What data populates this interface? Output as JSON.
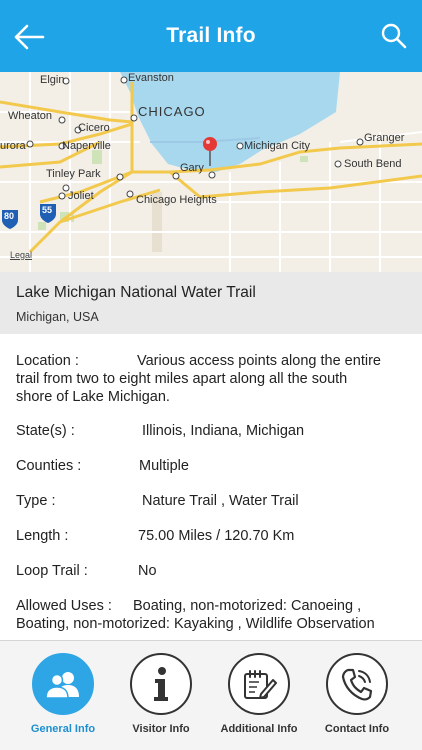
{
  "header": {
    "title": "Trail Info"
  },
  "map": {
    "labels": {
      "elgin": "Elgin",
      "evanston": "Evanston",
      "wheaton": "Wheaton",
      "chicago": "CHICAGO",
      "cicero": "Cicero",
      "aurora": "urora",
      "naperville": "Naperville",
      "michigan_city": "Michigan City",
      "granger": "Granger",
      "south_bend": "South Bend",
      "tinley_park": "Tinley Park",
      "gary": "Gary",
      "joliet": "Joliet",
      "chicago_heights": "Chicago Heights",
      "i80": "80",
      "i55": "55",
      "legal": "Legal"
    },
    "colors": {
      "water": "#a8d8ee",
      "land": "#f3efe6",
      "road": "#f2c94c",
      "pin": "#e53935"
    }
  },
  "trail": {
    "name": "Lake Michigan National Water Trail",
    "location": "Michigan, USA"
  },
  "details": {
    "location_label": "Location  :",
    "location_value": "Various access points along the entire",
    "location_line2": "trail from two to eight miles apart along all the south",
    "location_line3": "shore of Lake Michigan.",
    "states_label": "State(s)  :",
    "states_value": "Illinois, Indiana, Michigan",
    "counties_label": "Counties  :",
    "counties_value": "Multiple",
    "type_label": "Type   :",
    "type_value": "Nature Trail , Water Trail",
    "length_label": "Length   :",
    "length_value": "75.00 Miles / 120.70 Km",
    "loop_label": "Loop Trail  :",
    "loop_value": "No",
    "uses_label": "Allowed Uses  :",
    "uses_value": "Boating, non-motorized: Canoeing ,",
    "uses_line2": "Boating, non-motorized: Kayaking , Wildlife Observation"
  },
  "tabs": [
    {
      "label": "General Info",
      "icon": "users-icon",
      "active": true
    },
    {
      "label": "Visitor Info",
      "icon": "info-icon",
      "active": false
    },
    {
      "label": "Additional Info",
      "icon": "edit-icon",
      "active": false
    },
    {
      "label": "Contact Info",
      "icon": "phone-icon",
      "active": false
    }
  ]
}
